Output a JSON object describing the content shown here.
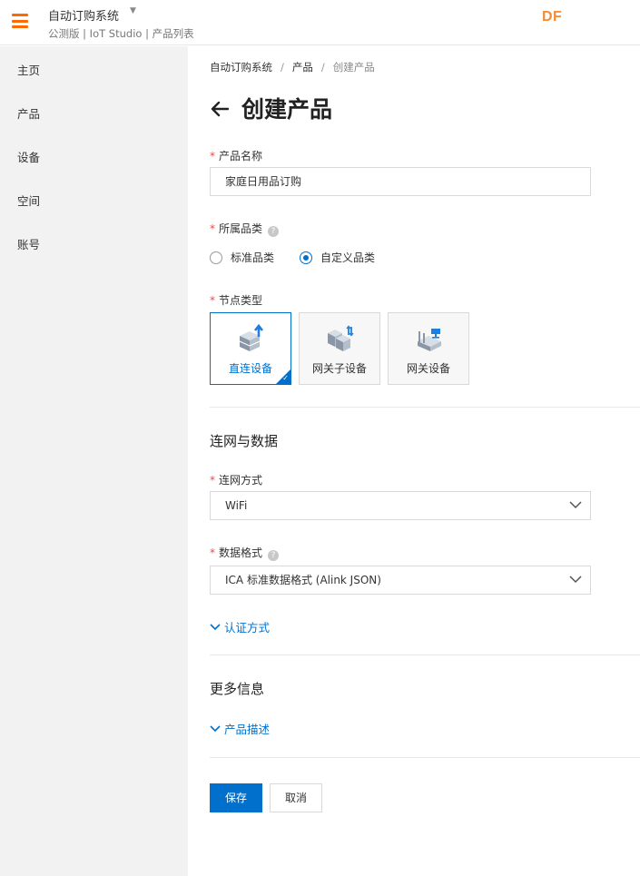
{
  "header": {
    "app_title": "自动订购系统",
    "subtitle": "公测版 | IoT Studio | 产品列表",
    "logo": "DF",
    "accent_color": "#ff6a00"
  },
  "sidebar": {
    "items": [
      {
        "label": "主页"
      },
      {
        "label": "产品"
      },
      {
        "label": "设备"
      },
      {
        "label": "空间"
      },
      {
        "label": "账号"
      }
    ]
  },
  "breadcrumb": [
    "自动订购系统",
    "产品",
    "创建产品"
  ],
  "page_title": "创建产品",
  "form": {
    "product_name": {
      "label": "产品名称",
      "value": "家庭日用品订购"
    },
    "category": {
      "label": "所属品类",
      "options": [
        "标准品类",
        "自定义品类"
      ],
      "selected": "自定义品类"
    },
    "node_type": {
      "label": "节点类型",
      "options": [
        {
          "label": "直连设备",
          "icon": "direct-device-icon",
          "selected": true
        },
        {
          "label": "网关子设备",
          "icon": "gateway-subdevice-icon",
          "selected": false
        },
        {
          "label": "网关设备",
          "icon": "gateway-device-icon",
          "selected": false
        }
      ]
    },
    "network_section_title": "连网与数据",
    "network_mode": {
      "label": "连网方式",
      "value": "WiFi"
    },
    "data_format": {
      "label": "数据格式",
      "value": "ICA 标准数据格式 (Alink JSON)"
    },
    "auth_expander": "认证方式",
    "more_section_title": "更多信息",
    "desc_expander": "产品描述"
  },
  "actions": {
    "save": "保存",
    "cancel": "取消"
  },
  "colors": {
    "primary": "#0070cc",
    "required": "#e94c4c"
  }
}
